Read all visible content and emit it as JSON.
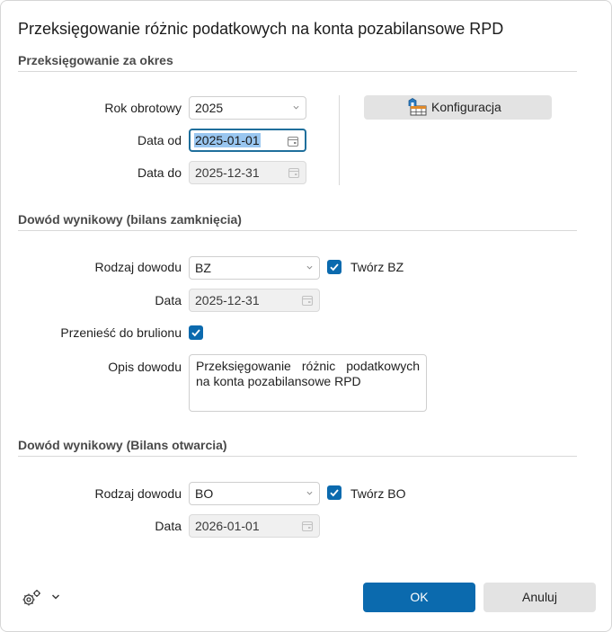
{
  "title": "Przeksięgowanie różnic podatkowych na konta pozabilansowe RPD",
  "period": {
    "section_title": "Przeksięgowanie za okres",
    "rok_label": "Rok obrotowy",
    "rok_value": "2025",
    "data_od_label": "Data od",
    "data_od_value": "2025-01-01",
    "data_do_label": "Data do",
    "data_do_value": "2025-12-31",
    "config_button": "Konfiguracja"
  },
  "bz": {
    "section_title": "Dowód wynikowy (bilans zamknięcia)",
    "rodzaj_label": "Rodzaj dowodu",
    "rodzaj_value": "BZ",
    "create_label": "Twórz BZ",
    "data_label": "Data",
    "data_value": "2025-12-31",
    "move_label": "Przenieść do brulionu",
    "opis_label": "Opis dowodu",
    "opis_value": "Przeksięgowanie różnic podatkowych na konta pozabilansowe RPD"
  },
  "bo": {
    "section_title": "Dowód wynikowy (Bilans otwarcia)",
    "rodzaj_label": "Rodzaj dowodu",
    "rodzaj_value": "BO",
    "create_label": "Twórz BO",
    "data_label": "Data",
    "data_value": "2026-01-01"
  },
  "footer": {
    "ok_label": "OK",
    "cancel_label": "Anuluj"
  },
  "colors": {
    "accent": "#0b6aae",
    "focus": "#1f6f9c"
  }
}
